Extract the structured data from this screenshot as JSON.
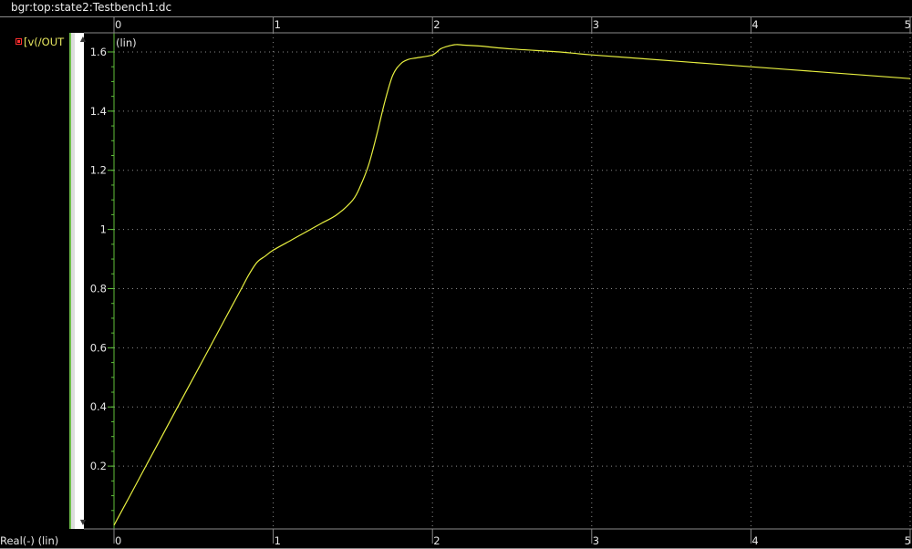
{
  "window": {
    "title": "bgr:top:state2:Testbench1:dc"
  },
  "legend": {
    "trace_label": "[v(/OUT",
    "marker_color": "#ff3030"
  },
  "footer": {
    "x_axis_label": "Real(-) (lin)"
  },
  "colors": {
    "background": "#000000",
    "trace": "#e8f040",
    "grid": "#8a8a8a",
    "axis": "#5fbf3a"
  },
  "icons": {
    "scroll_up": "triangle-up",
    "scroll_down": "triangle-down"
  },
  "chart_data": {
    "type": "line",
    "title": "",
    "xlabel": "Real(-) (lin)",
    "ylabel": "(lin)",
    "xlim": [
      0,
      5
    ],
    "ylim": [
      0,
      1.64
    ],
    "x_ticks": [
      "0",
      "1",
      "2",
      "3",
      "4",
      "5"
    ],
    "y_ticks": [
      "0.2",
      "0.4",
      "0.6",
      "0.8",
      "1",
      "1.2",
      "1.4",
      "1.6"
    ],
    "grid": true,
    "series": [
      {
        "name": "[v(/OUT",
        "x": [
          0,
          0.1,
          0.2,
          0.3,
          0.4,
          0.5,
          0.6,
          0.7,
          0.8,
          0.85,
          0.9,
          0.95,
          1.0,
          1.1,
          1.2,
          1.3,
          1.4,
          1.5,
          1.55,
          1.6,
          1.65,
          1.7,
          1.75,
          1.8,
          1.85,
          1.9,
          2.0,
          2.05,
          2.1,
          2.15,
          2.2,
          2.3,
          2.5,
          2.8,
          3.0,
          3.5,
          4.0,
          4.5,
          5.0
        ],
        "y": [
          0.0,
          0.1,
          0.2,
          0.3,
          0.4,
          0.5,
          0.6,
          0.7,
          0.8,
          0.85,
          0.89,
          0.91,
          0.93,
          0.96,
          0.99,
          1.02,
          1.05,
          1.1,
          1.15,
          1.22,
          1.32,
          1.43,
          1.52,
          1.56,
          1.575,
          1.58,
          1.59,
          1.61,
          1.62,
          1.625,
          1.623,
          1.62,
          1.61,
          1.6,
          1.59,
          1.57,
          1.55,
          1.53,
          1.51
        ]
      }
    ]
  }
}
